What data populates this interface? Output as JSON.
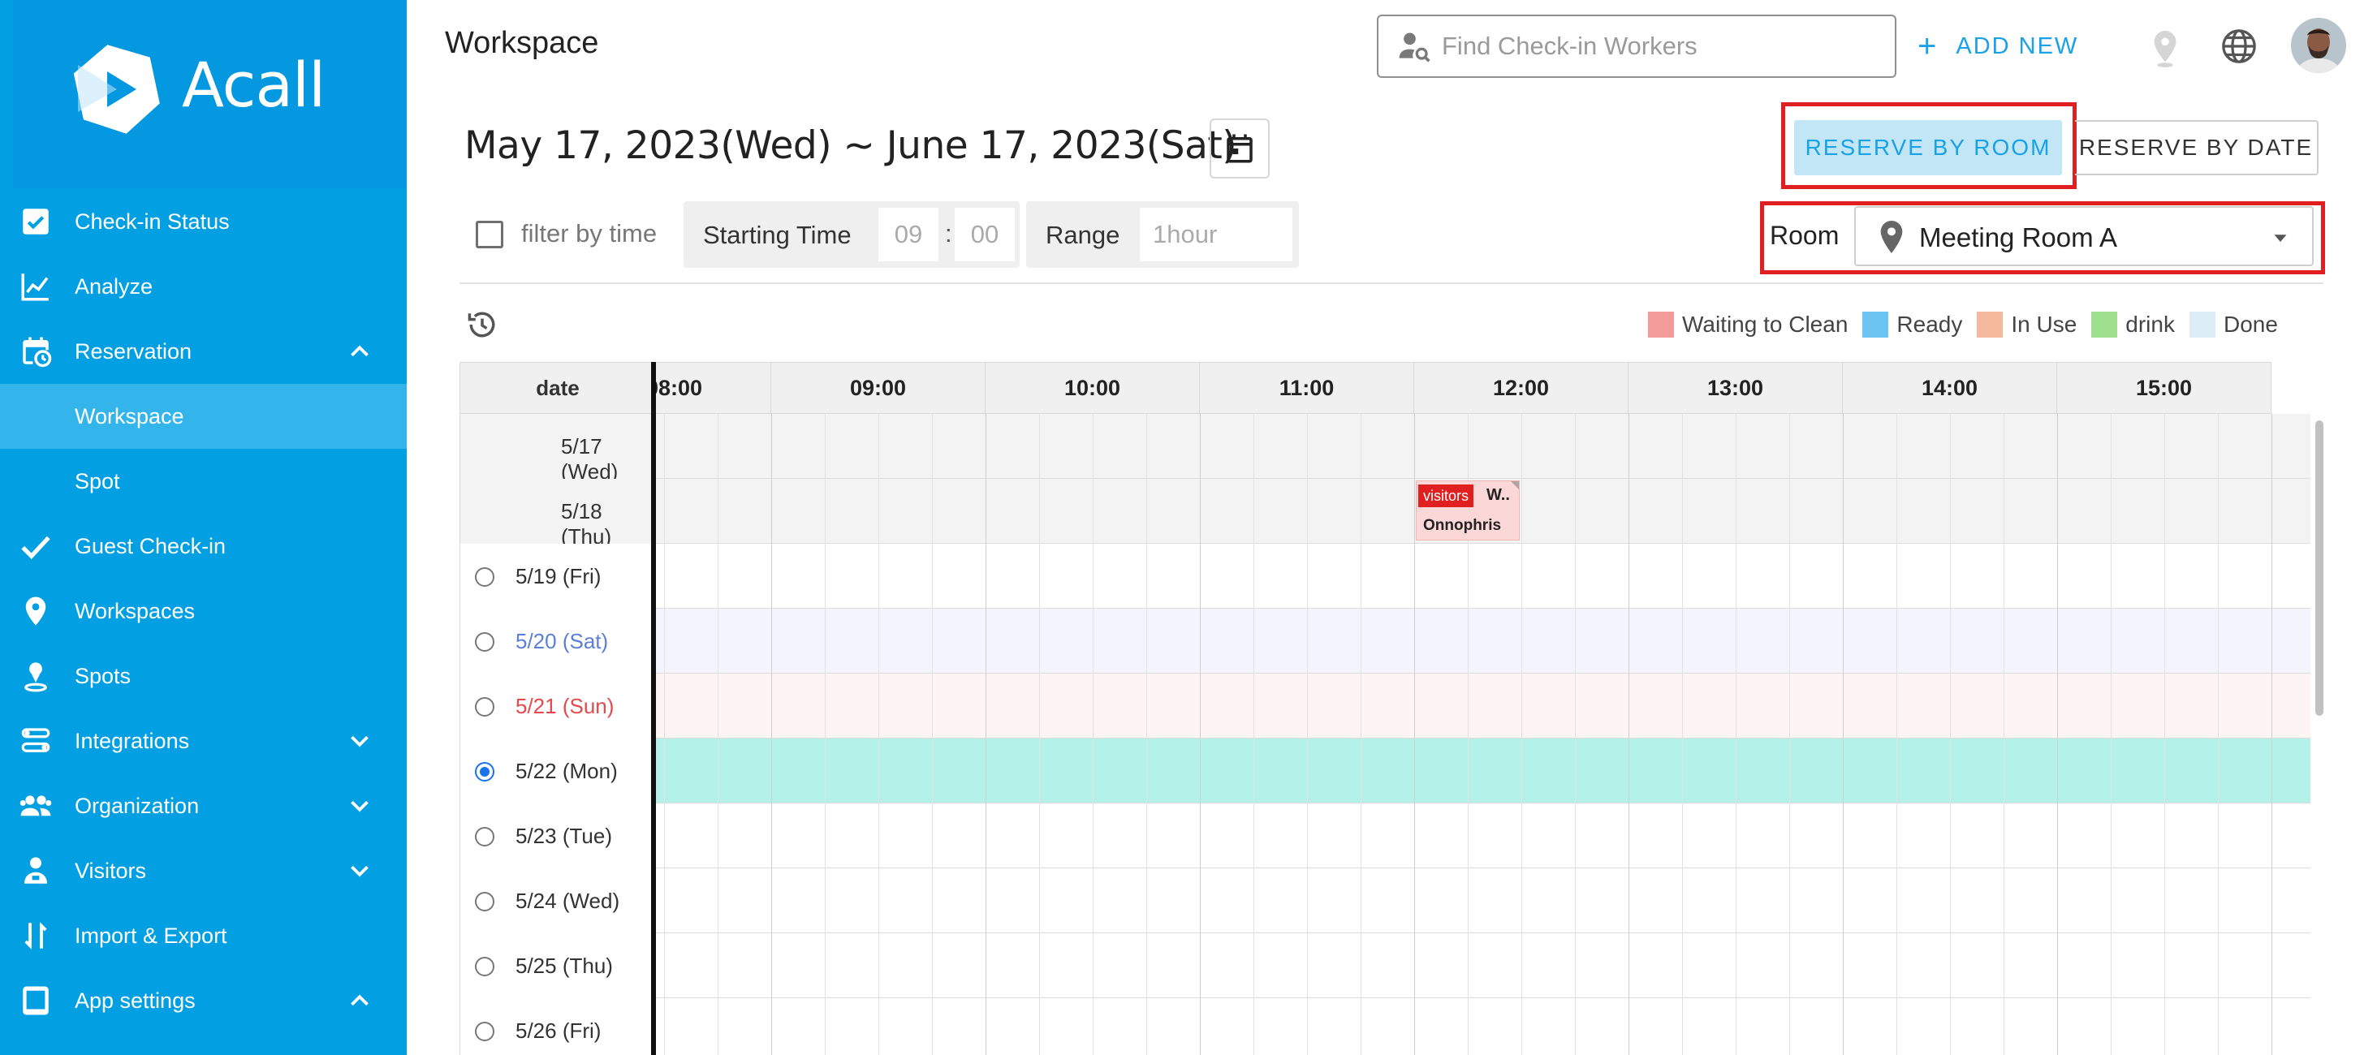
{
  "brand": {
    "name": "Acall",
    "sidebar_color": "#029fe3"
  },
  "sidebar": {
    "items": [
      {
        "label": "Check-in Status",
        "icon": "checkbox-icon"
      },
      {
        "label": "Analyze",
        "icon": "chart-icon"
      },
      {
        "label": "Reservation",
        "icon": "calendar-clock-icon",
        "expanded": true
      },
      {
        "label": "Workspace",
        "active": true
      },
      {
        "label": "Spot"
      },
      {
        "label": "Guest Check-in",
        "icon": "check-icon"
      },
      {
        "label": "Workspaces",
        "icon": "map-pin-icon"
      },
      {
        "label": "Spots",
        "icon": "person-pin-icon"
      },
      {
        "label": "Integrations",
        "icon": "integrations-icon",
        "expanded": false
      },
      {
        "label": "Organization",
        "icon": "people-icon",
        "expanded": false
      },
      {
        "label": "Visitors",
        "icon": "visitor-icon",
        "expanded": false
      },
      {
        "label": "Import & Export",
        "icon": "import-export-icon"
      },
      {
        "label": "App settings",
        "icon": "tablet-icon",
        "expanded": true
      }
    ]
  },
  "header": {
    "title": "Workspace",
    "search_placeholder": "Find Check-in Workers",
    "add_new_label": "ADD NEW"
  },
  "toolbar": {
    "date_range": "May 17, 2023(Wed) ~ June 17, 2023(Sat)",
    "reserve_by_room": "RESERVE BY ROOM",
    "reserve_by_date": "RESERVE BY DATE",
    "filter_label": "filter by time",
    "starting_time_label": "Starting Time",
    "start_hour": "09",
    "start_colon": ":",
    "start_minute": "00",
    "range_label": "Range",
    "range_value": "1hour",
    "room_label": "Room",
    "room_value": "Meeting Room A"
  },
  "legend": [
    {
      "label": "Waiting to Clean",
      "color": "#f29b9b"
    },
    {
      "label": "Ready",
      "color": "#6cc4f3"
    },
    {
      "label": "In Use",
      "color": "#f7b99b"
    },
    {
      "label": "drink",
      "color": "#9fe08e"
    },
    {
      "label": "Done",
      "color": "#dcecf6"
    }
  ],
  "grid": {
    "date_header": "date",
    "hours": [
      "08:00",
      "09:00",
      "10:00",
      "11:00",
      "12:00",
      "13:00",
      "14:00",
      "15:00"
    ],
    "rows": [
      {
        "label": "5/17 (Wed)",
        "type": "past",
        "radio": false
      },
      {
        "label": "5/18 (Thu)",
        "type": "past",
        "radio": false
      },
      {
        "label": "5/19 (Fri)",
        "type": "weekday",
        "radio": true
      },
      {
        "label": "5/20 (Sat)",
        "type": "saturday",
        "radio": true
      },
      {
        "label": "5/21 (Sun)",
        "type": "sunday",
        "radio": true
      },
      {
        "label": "5/22 (Mon)",
        "type": "selected",
        "radio": true,
        "checked": true
      },
      {
        "label": "5/23 (Tue)",
        "type": "weekday",
        "radio": true
      },
      {
        "label": "5/24 (Wed)",
        "type": "weekday",
        "radio": true
      },
      {
        "label": "5/25 (Thu)",
        "type": "weekday",
        "radio": true
      },
      {
        "label": "5/26 (Fri)",
        "type": "weekday",
        "radio": true
      }
    ],
    "event": {
      "tag": "visitors",
      "title": "W..",
      "name": "Onnophris",
      "row": 1,
      "start": "12:00",
      "end": "12:30"
    },
    "colors": {
      "past": "#f3f3f3",
      "saturday": "#f3f4fc",
      "sunday": "#fdf4f4",
      "selected": "#b3f1e9",
      "weekday": "#ffffff",
      "saturday_text": "#5b7fd6",
      "sunday_text": "#e5484d"
    }
  }
}
